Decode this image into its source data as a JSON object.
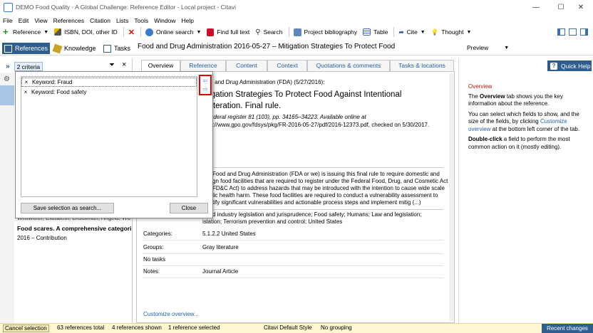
{
  "window": {
    "title": "DEMO Food Quality - A Global Challenge: Reference Editor - Local project - Citavi",
    "minimize": "—",
    "maximize": "☐",
    "close": "✕"
  },
  "menu": [
    "File",
    "Edit",
    "View",
    "References",
    "Citation",
    "Lists",
    "Tools",
    "Window",
    "Help"
  ],
  "toolbar": {
    "reference": "Reference",
    "isbn": "ISBN, DOI, other ID",
    "online_search": "Online search",
    "find_full_text": "Find full text",
    "search": "Search",
    "project_bibliography": "Project bibliography",
    "table": "Table",
    "cite": "Cite",
    "thought": "Thought"
  },
  "nav": {
    "references": "References",
    "knowledge": "Knowledge",
    "tasks": "Tasks"
  },
  "left": {
    "expand": "»",
    "criteria_label": "2 criteria",
    "close": "×",
    "list_item": {
      "authors": "Whitworth, Elizabeth; Druckman, Angela; Wo",
      "title": "Food scares. A comprehensive categorisatio",
      "meta": "2016 – Contribution"
    }
  },
  "popup": {
    "criteria": [
      {
        "remove": "×",
        "label": "Keyword: Fraud"
      },
      {
        "remove": "×",
        "label": "Keyword: Food safety"
      }
    ],
    "save_button": "Save selection as search...",
    "close_button": "Close"
  },
  "main": {
    "header": "Food and Drug Administration 2016-05-27 – Mitigation Strategies To Protect Food",
    "tabs": [
      "Overview",
      "Reference",
      "Content",
      "Context",
      "Quotations & comments",
      "Tasks & locations"
    ],
    "citation_line": "od and Drug Administration (FDA) (5/27/2016):",
    "title_line1": "tigation Strategies To Protect Food Against Intentional",
    "title_line2": "ulteration. Final rule.",
    "source_line1": "Federal register 81 (103), pp. 34165–34223. Available online at",
    "source_line2": "ps://www.gpo.gov/fdsys/pkg/FR-2016-05-27/pdf/2016-12373.pdf, checked on 5/30/2017.",
    "abstract": [
      "Food and Drug Administration (FDA or we) is issuing this final rule to require domestic and",
      "gn food facilities that are required to register under the Federal Food, Drug, and Cosmetic Act",
      "FD&C Act) to address hazards that may be introduced with the intention to cause wide scale",
      "lic health harm. These food facilities are required to conduct a vulnerability assessment to",
      "tify significant vulnerabilities and actionable process steps and implement mitig (...)"
    ],
    "keywords_line1": "d industry legislation and jurisprudence; Food safety; Humans; Law and legislation;",
    "keywords_line2": "islation; Terrorism prevention and control; United States",
    "categories_label": "Categories:",
    "categories_value": "5.1.2.2 United States",
    "groups_label": "Groups:",
    "groups_value": "Gray literature",
    "no_tasks": "No tasks",
    "notes_label": "Notes:",
    "notes_value": "Journal Article",
    "customize": "Customize overview..."
  },
  "right": {
    "preview": "Preview",
    "quick_help": "Quick Help",
    "overview_heading": "Overview",
    "p1_pre": "The ",
    "p1_bold": "Overview",
    "p1_post": " tab shows you the key information about the reference.",
    "p2_pre": "You can select which fields to show, and the size of the fields, by clicking ",
    "p2_link": "Customize overview",
    "p2_post": " at the bottom left corner of the tab.",
    "p3_bold": "Double-click",
    "p3_post": " a field to perform the most common action on it (mostly editing)."
  },
  "status": {
    "cancel_selection": "Cancel selection",
    "total": "63 references total",
    "shown": "4 references shown",
    "selected": "1 reference selected",
    "style": "Citavi Default Style",
    "grouping": "No grouping",
    "recent_changes": "Recent changes"
  },
  "colors": {
    "accent_blue": "#2e5d8e",
    "link_blue": "#2360a8",
    "highlight_red": "#e00000",
    "status_yellow": "#fdf6d0"
  }
}
